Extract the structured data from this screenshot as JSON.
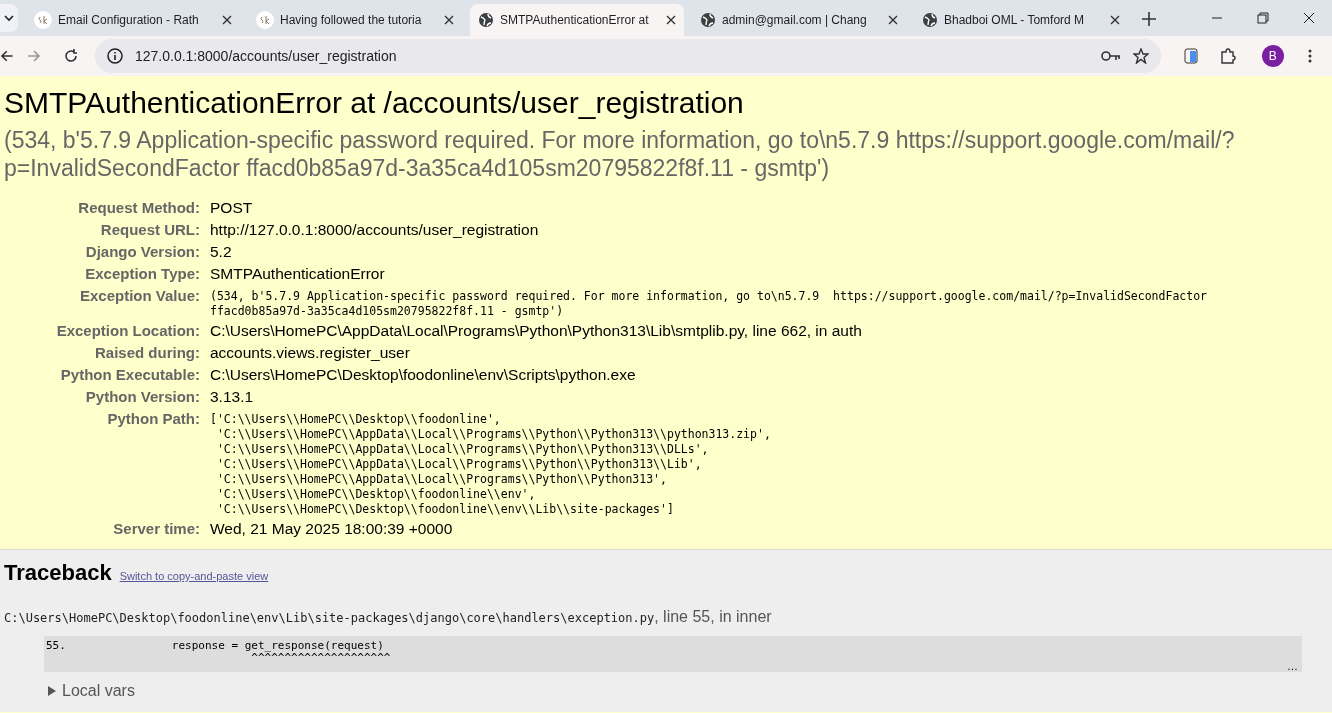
{
  "browser": {
    "tabs": [
      {
        "title": "Email Configuration - Rath",
        "kind": "logo",
        "selected": false
      },
      {
        "title": "Having followed the tutoria",
        "kind": "logo",
        "selected": false
      },
      {
        "title": "SMTPAuthenticationError at",
        "kind": "globe",
        "selected": true
      },
      {
        "title": "admin@gmail.com | Chang",
        "kind": "globe",
        "selected": false
      },
      {
        "title": "Bhadboi OML - Tomford M",
        "kind": "globe",
        "selected": false
      }
    ],
    "address": "127.0.0.1:8000/accounts/user_registration",
    "profile": "B"
  },
  "error": {
    "title": "SMTPAuthenticationError at /accounts/user_registration",
    "summary": "(534, b'5.7.9 Application-specific password required. For more information, go to\\n5.7.9  https://support.google.com/mail/?p=InvalidSecondFactor ffacd0b85a97d-3a35ca4d105sm20795822f8f.11 - gsmtp')",
    "meta": [
      {
        "label": "Request Method:",
        "value": "POST",
        "kind": "text"
      },
      {
        "label": "Request URL:",
        "value": "http://127.0.0.1:8000/accounts/user_registration",
        "kind": "text"
      },
      {
        "label": "Django Version:",
        "value": "5.2",
        "kind": "text"
      },
      {
        "label": "Exception Type:",
        "value": "SMTPAuthenticationError",
        "kind": "text"
      },
      {
        "label": "Exception Value:",
        "value": "(534, b'5.7.9 Application-specific password required. For more information, go to\\n5.7.9  https://support.google.com/mail/?p=InvalidSecondFactor\nffacd0b85a97d-3a35ca4d105sm20795822f8f.11 - gsmtp')",
        "kind": "code"
      },
      {
        "label": "Exception Location:",
        "value": "C:\\Users\\HomePC\\AppData\\Local\\Programs\\Python\\Python313\\Lib\\smtplib.py, line 662, in auth",
        "kind": "text"
      },
      {
        "label": "Raised during:",
        "value": "accounts.views.register_user",
        "kind": "text"
      },
      {
        "label": "Python Executable:",
        "value": "C:\\Users\\HomePC\\Desktop\\foodonline\\env\\Scripts\\python.exe",
        "kind": "text"
      },
      {
        "label": "Python Version:",
        "value": "3.13.1",
        "kind": "text"
      },
      {
        "label": "Python Path:",
        "value": "['C:\\\\Users\\\\HomePC\\\\Desktop\\\\foodonline',\n 'C:\\\\Users\\\\HomePC\\\\AppData\\\\Local\\\\Programs\\\\Python\\\\Python313\\\\python313.zip',\n 'C:\\\\Users\\\\HomePC\\\\AppData\\\\Local\\\\Programs\\\\Python\\\\Python313\\\\DLLs',\n 'C:\\\\Users\\\\HomePC\\\\AppData\\\\Local\\\\Programs\\\\Python\\\\Python313\\\\Lib',\n 'C:\\\\Users\\\\HomePC\\\\AppData\\\\Local\\\\Programs\\\\Python\\\\Python313',\n 'C:\\\\Users\\\\HomePC\\\\Desktop\\\\foodonline\\\\env',\n 'C:\\\\Users\\\\HomePC\\\\Desktop\\\\foodonline\\\\env\\\\Lib\\\\site-packages']",
        "kind": "code"
      },
      {
        "label": "Server time:",
        "value": "Wed, 21 May 2025 18:00:39 +0000",
        "kind": "text"
      }
    ]
  },
  "traceback": {
    "title": "Traceback",
    "switch_link": "Switch to copy-and-paste view",
    "frame": {
      "file": "C:\\Users\\HomePC\\Desktop\\foodonline\\env\\Lib\\site-packages\\django\\core\\handlers\\exception.py",
      "location": ", line 55, in inner",
      "line_number": "55.",
      "code": "                response = get_response(request)",
      "carets": "                           ^^^^^^^^^^^^^^^^^^^^^",
      "more": "…",
      "local_vars": {
        "label": "Local vars",
        "expanded": false
      }
    }
  }
}
